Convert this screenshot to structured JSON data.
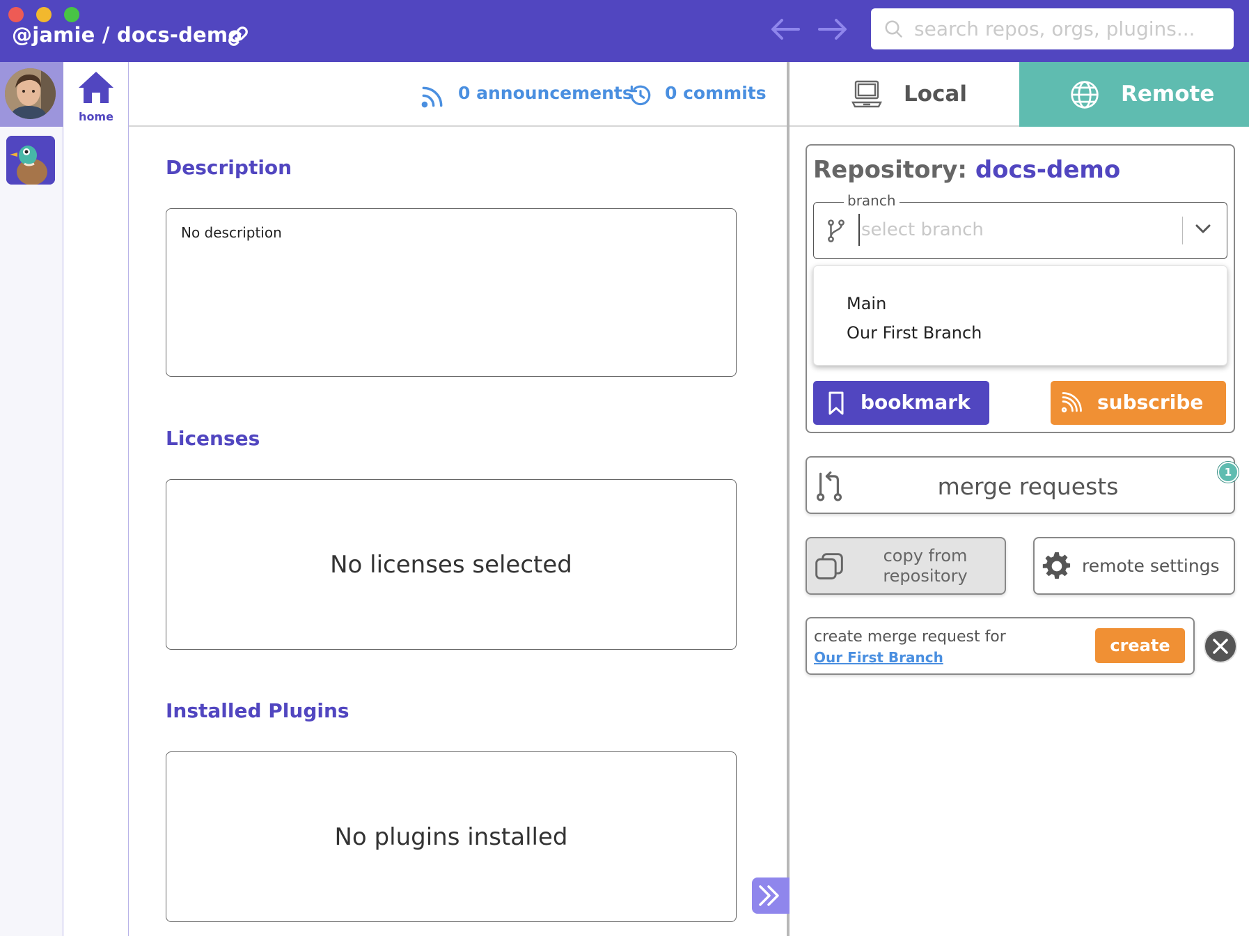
{
  "window": {
    "breadcrumb": "@jamie / docs-demo",
    "search_placeholder": "search repos, orgs, plugins..."
  },
  "sidebar": {
    "home_label": "home"
  },
  "stats": {
    "announcements": "0 announcements",
    "commits": "0 commits"
  },
  "main": {
    "description": {
      "title": "Description",
      "text": "No description"
    },
    "licenses": {
      "title": "Licenses",
      "empty": "No licenses selected"
    },
    "plugins": {
      "title": "Installed Plugins",
      "empty": "No plugins installed"
    }
  },
  "tabs": {
    "local": "Local",
    "remote": "Remote",
    "active": "Remote"
  },
  "repo": {
    "label": "Repository:",
    "name": "docs-demo",
    "branch_legend": "branch",
    "branch_placeholder": "select branch",
    "branch_options": [
      "Main",
      "Our First Branch"
    ],
    "bookmark_label": "bookmark",
    "subscribe_label": "subscribe"
  },
  "actions": {
    "merge_requests_label": "merge requests",
    "merge_requests_count": "1",
    "copy_label": "copy from repository",
    "settings_label": "remote settings",
    "create_text": "create merge request for",
    "create_branch": "Our First Branch",
    "create_label": "create"
  },
  "colors": {
    "brand": "#5146c0",
    "remote_tab": "#5fbcb0",
    "accent_orange": "#f09034",
    "link_blue": "#4a8fe0"
  }
}
